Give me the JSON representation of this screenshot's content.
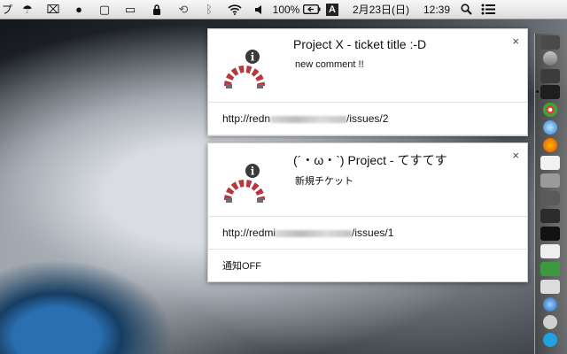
{
  "menubar": {
    "left_glyph": "プ",
    "items": [
      {
        "name": "growl-icon",
        "glyph": "☂"
      },
      {
        "name": "airdrop-icon",
        "glyph": "⌧"
      },
      {
        "name": "bowler-hat-icon",
        "glyph": "●"
      },
      {
        "name": "window-square-icon",
        "glyph": "▢"
      },
      {
        "name": "airplay-icon",
        "glyph": "▭"
      },
      {
        "name": "lock-icon",
        "glyph": "🔒"
      },
      {
        "name": "time-machine-icon",
        "glyph": "⟲"
      },
      {
        "name": "bluetooth-icon",
        "glyph": "ᛒ"
      },
      {
        "name": "wifi-icon",
        "glyph": "≋"
      },
      {
        "name": "volume-icon",
        "glyph": "◀"
      }
    ],
    "battery_percent": "100%",
    "input_method": "A",
    "date": "2月23日(日)",
    "time": "12:39",
    "search_glyph": "⌕",
    "list_glyph": "☰"
  },
  "notifications": [
    {
      "title": "Project X - ticket title :-D",
      "body": "new comment !!",
      "link_prefix": "http://redn",
      "link_suffix": "/issues/2",
      "close": "×"
    },
    {
      "title": "(´・ω・`) Project - てすてす",
      "body": "新規チケット",
      "link_prefix": "http://redmi",
      "link_suffix": "/issues/1",
      "close": "×",
      "action": "通知OFF"
    }
  ],
  "colors": {
    "redmine_red": "#b6383f",
    "redmine_gray": "#6d6d6d",
    "info_badge": "#3a3a3a"
  }
}
